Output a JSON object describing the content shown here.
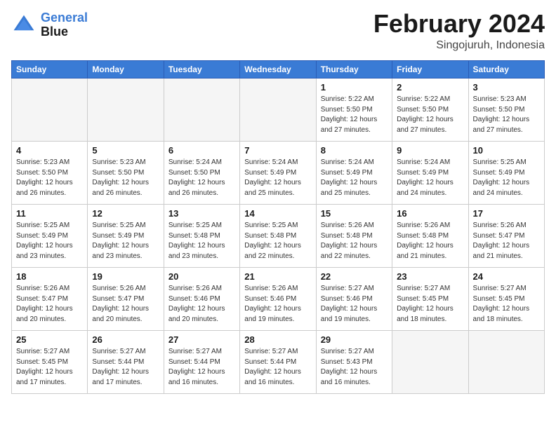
{
  "header": {
    "logo_line1": "General",
    "logo_line2": "Blue",
    "month_title": "February 2024",
    "subtitle": "Singojuruh, Indonesia"
  },
  "weekdays": [
    "Sunday",
    "Monday",
    "Tuesday",
    "Wednesday",
    "Thursday",
    "Friday",
    "Saturday"
  ],
  "weeks": [
    [
      {
        "day": "",
        "info": ""
      },
      {
        "day": "",
        "info": ""
      },
      {
        "day": "",
        "info": ""
      },
      {
        "day": "",
        "info": ""
      },
      {
        "day": "1",
        "info": "Sunrise: 5:22 AM\nSunset: 5:50 PM\nDaylight: 12 hours\nand 27 minutes."
      },
      {
        "day": "2",
        "info": "Sunrise: 5:22 AM\nSunset: 5:50 PM\nDaylight: 12 hours\nand 27 minutes."
      },
      {
        "day": "3",
        "info": "Sunrise: 5:23 AM\nSunset: 5:50 PM\nDaylight: 12 hours\nand 27 minutes."
      }
    ],
    [
      {
        "day": "4",
        "info": "Sunrise: 5:23 AM\nSunset: 5:50 PM\nDaylight: 12 hours\nand 26 minutes."
      },
      {
        "day": "5",
        "info": "Sunrise: 5:23 AM\nSunset: 5:50 PM\nDaylight: 12 hours\nand 26 minutes."
      },
      {
        "day": "6",
        "info": "Sunrise: 5:24 AM\nSunset: 5:50 PM\nDaylight: 12 hours\nand 26 minutes."
      },
      {
        "day": "7",
        "info": "Sunrise: 5:24 AM\nSunset: 5:49 PM\nDaylight: 12 hours\nand 25 minutes."
      },
      {
        "day": "8",
        "info": "Sunrise: 5:24 AM\nSunset: 5:49 PM\nDaylight: 12 hours\nand 25 minutes."
      },
      {
        "day": "9",
        "info": "Sunrise: 5:24 AM\nSunset: 5:49 PM\nDaylight: 12 hours\nand 24 minutes."
      },
      {
        "day": "10",
        "info": "Sunrise: 5:25 AM\nSunset: 5:49 PM\nDaylight: 12 hours\nand 24 minutes."
      }
    ],
    [
      {
        "day": "11",
        "info": "Sunrise: 5:25 AM\nSunset: 5:49 PM\nDaylight: 12 hours\nand 23 minutes."
      },
      {
        "day": "12",
        "info": "Sunrise: 5:25 AM\nSunset: 5:49 PM\nDaylight: 12 hours\nand 23 minutes."
      },
      {
        "day": "13",
        "info": "Sunrise: 5:25 AM\nSunset: 5:48 PM\nDaylight: 12 hours\nand 23 minutes."
      },
      {
        "day": "14",
        "info": "Sunrise: 5:25 AM\nSunset: 5:48 PM\nDaylight: 12 hours\nand 22 minutes."
      },
      {
        "day": "15",
        "info": "Sunrise: 5:26 AM\nSunset: 5:48 PM\nDaylight: 12 hours\nand 22 minutes."
      },
      {
        "day": "16",
        "info": "Sunrise: 5:26 AM\nSunset: 5:48 PM\nDaylight: 12 hours\nand 21 minutes."
      },
      {
        "day": "17",
        "info": "Sunrise: 5:26 AM\nSunset: 5:47 PM\nDaylight: 12 hours\nand 21 minutes."
      }
    ],
    [
      {
        "day": "18",
        "info": "Sunrise: 5:26 AM\nSunset: 5:47 PM\nDaylight: 12 hours\nand 20 minutes."
      },
      {
        "day": "19",
        "info": "Sunrise: 5:26 AM\nSunset: 5:47 PM\nDaylight: 12 hours\nand 20 minutes."
      },
      {
        "day": "20",
        "info": "Sunrise: 5:26 AM\nSunset: 5:46 PM\nDaylight: 12 hours\nand 20 minutes."
      },
      {
        "day": "21",
        "info": "Sunrise: 5:26 AM\nSunset: 5:46 PM\nDaylight: 12 hours\nand 19 minutes."
      },
      {
        "day": "22",
        "info": "Sunrise: 5:27 AM\nSunset: 5:46 PM\nDaylight: 12 hours\nand 19 minutes."
      },
      {
        "day": "23",
        "info": "Sunrise: 5:27 AM\nSunset: 5:45 PM\nDaylight: 12 hours\nand 18 minutes."
      },
      {
        "day": "24",
        "info": "Sunrise: 5:27 AM\nSunset: 5:45 PM\nDaylight: 12 hours\nand 18 minutes."
      }
    ],
    [
      {
        "day": "25",
        "info": "Sunrise: 5:27 AM\nSunset: 5:45 PM\nDaylight: 12 hours\nand 17 minutes."
      },
      {
        "day": "26",
        "info": "Sunrise: 5:27 AM\nSunset: 5:44 PM\nDaylight: 12 hours\nand 17 minutes."
      },
      {
        "day": "27",
        "info": "Sunrise: 5:27 AM\nSunset: 5:44 PM\nDaylight: 12 hours\nand 16 minutes."
      },
      {
        "day": "28",
        "info": "Sunrise: 5:27 AM\nSunset: 5:44 PM\nDaylight: 12 hours\nand 16 minutes."
      },
      {
        "day": "29",
        "info": "Sunrise: 5:27 AM\nSunset: 5:43 PM\nDaylight: 12 hours\nand 16 minutes."
      },
      {
        "day": "",
        "info": ""
      },
      {
        "day": "",
        "info": ""
      }
    ]
  ]
}
